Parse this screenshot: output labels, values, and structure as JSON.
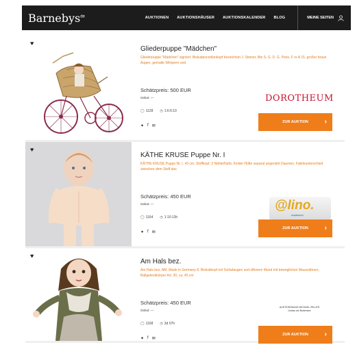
{
  "header": {
    "logo": "Barnebys",
    "logo_suffix": "de",
    "menu": [
      "AUKTIONEN",
      "AUKTIONSHÄUSER",
      "AUKTIONSKALENDER",
      "BLOG"
    ],
    "account_label": "MEINE SEITEN"
  },
  "listings": [
    {
      "title": "Gliederpuppe \"Mädchen\"",
      "description": "Gliederpuppe \"Mädchen\" signiert. Biskuitporzellankopf bezeichnet J. Steiner, Bte S. G. D. G. Paris. F re A 15, großer braun Augen, gemalte Wimpern und",
      "price": "Schätzpreis: 500 EUR",
      "bid": "Gebot: —",
      "views": "1128",
      "time": "1:6:6:10",
      "house": "DOROTHEUM",
      "button": "ZUR AUKTION"
    },
    {
      "title": "KÄTHE KRUSE Puppe Nr. I",
      "description": "KÄTHE KRUSE Puppe Nr. I, 43 cm. Stoffkopf, 3 Nähte/Naht, Kinder Hüfte separat angenäht Daumen, Fabrikunterschied zwischen dem Stoff das",
      "price": "Schätzpreis: 450 EUR",
      "bid": "Gebot: —",
      "views": "1164",
      "time": "1:10:13h",
      "house": "@lino.",
      "house_sub": "Auktionen",
      "button": "ZUR AUKTION"
    },
    {
      "title": "Am Hals bez.",
      "description": "Am Hals bez. AM. Made in Germany 8. Biskuitkopf mit Schlafaugen und offenem Mund mit beweglichen Mauszähnen, Ballgelenkkörper Art. 30, ca. 45 cm",
      "price": "Schätzpreis: 450 EUR",
      "bid": "Gebot: —",
      "views": "1168",
      "time": "3d 07h",
      "house": "AUKTIONSHAUS MICHAEL ZELLER",
      "house_sub": "Lindau am Bodensee",
      "button": "ZUR AUKTION"
    }
  ],
  "colors": {
    "accent": "#ef7d1a",
    "nav": "#1c1c1c",
    "dorotheum": "#c8102e"
  }
}
